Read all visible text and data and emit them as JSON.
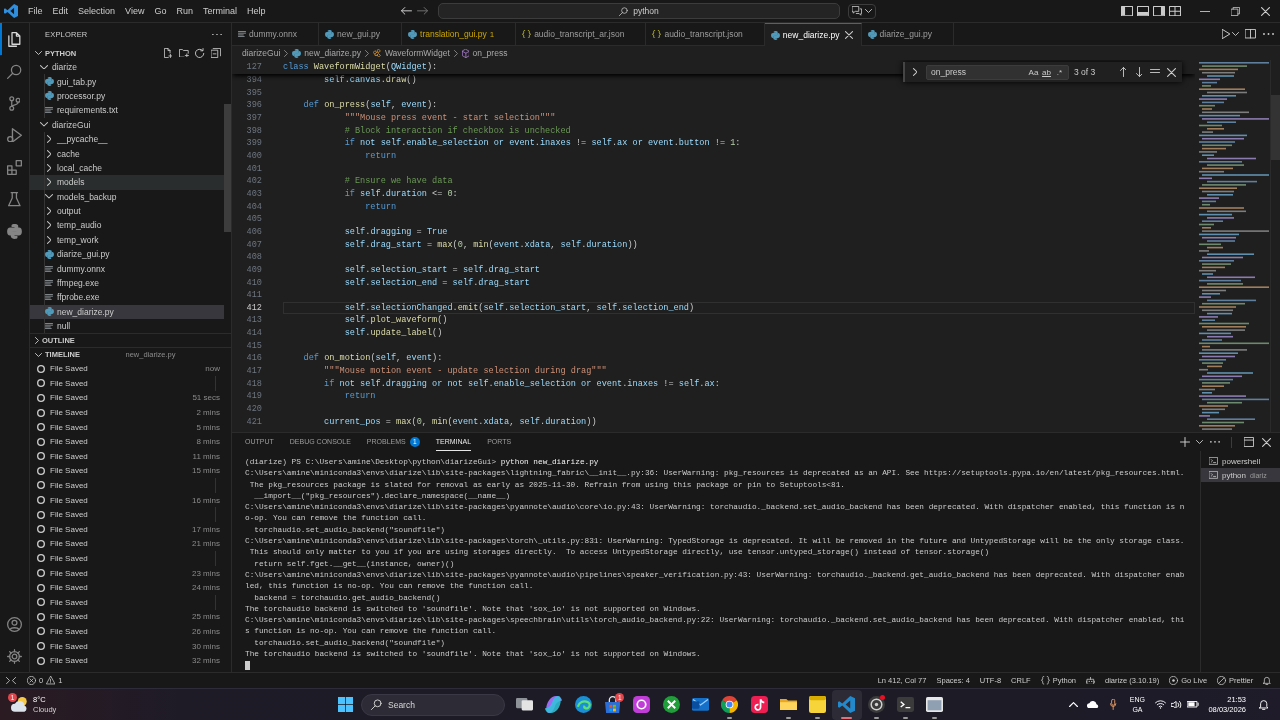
{
  "title_bar": {
    "menu": [
      "File",
      "Edit",
      "Selection",
      "View",
      "Go",
      "Run",
      "Terminal",
      "Help"
    ],
    "command_center": {
      "label": "python"
    }
  },
  "activity_bar": {
    "items": [
      {
        "kind": "explorer",
        "selected": true
      },
      {
        "kind": "search",
        "selected": false
      },
      {
        "kind": "source_control",
        "selected": false
      },
      {
        "kind": "run_debug",
        "selected": false
      },
      {
        "kind": "extensions",
        "selected": false
      },
      {
        "kind": "testing",
        "selected": false
      },
      {
        "kind": "python",
        "selected": false
      }
    ],
    "bottom": [
      {
        "kind": "account"
      },
      {
        "kind": "settings"
      }
    ]
  },
  "sidebar": {
    "title": "EXPLORER",
    "section": {
      "label": "PYTHON",
      "expanded": true
    },
    "tree": [
      {
        "label": "diarize",
        "kind": "folder",
        "expanded": true,
        "selected": false,
        "hovered": false,
        "children": [
          {
            "label": "gui_tab.py",
            "kind": "python",
            "selected": false,
            "hovered": false
          },
          {
            "label": "processor.py",
            "kind": "python",
            "selected": false,
            "hovered": false
          },
          {
            "label": "requirements.txt",
            "kind": "text",
            "selected": false,
            "hovered": false
          }
        ]
      },
      {
        "label": "diarizeGui",
        "kind": "folder",
        "expanded": true,
        "selected": false,
        "hovered": false,
        "children": [
          {
            "label": "__pycache__",
            "kind": "folder",
            "expanded": false,
            "selected": false,
            "hovered": false
          },
          {
            "label": "cache",
            "kind": "folder",
            "expanded": false,
            "selected": false,
            "hovered": false
          },
          {
            "label": "local_cache",
            "kind": "folder",
            "expanded": false,
            "selected": false,
            "hovered": false
          },
          {
            "label": "models",
            "kind": "folder",
            "expanded": false,
            "selected": false,
            "hovered": true
          },
          {
            "label": "models_backup",
            "kind": "folder",
            "expanded": true,
            "selected": false,
            "hovered": false
          },
          {
            "label": "output",
            "kind": "folder",
            "expanded": false,
            "selected": false,
            "hovered": false
          },
          {
            "label": "temp_audio",
            "kind": "folder",
            "expanded": false,
            "selected": false,
            "hovered": false
          },
          {
            "label": "temp_work",
            "kind": "folder",
            "expanded": false,
            "selected": false,
            "hovered": false
          },
          {
            "label": "diarize_gui.py",
            "kind": "python",
            "selected": false,
            "hovered": false
          },
          {
            "label": "dummy.onnx",
            "kind": "text",
            "selected": false,
            "hovered": false
          },
          {
            "label": "ffmpeg.exe",
            "kind": "text",
            "selected": false,
            "hovered": false
          },
          {
            "label": "ffprobe.exe",
            "kind": "text",
            "selected": false,
            "hovered": false
          },
          {
            "label": "new_diarize.py",
            "kind": "python",
            "selected": true,
            "hovered": false
          },
          {
            "label": "null",
            "kind": "text",
            "selected": false,
            "hovered": false
          }
        ]
      }
    ],
    "outline": {
      "label": "OUTLINE",
      "expanded": false
    },
    "timeline": {
      "label": "TIMELINE",
      "file": "new_diarize.py",
      "expanded": true,
      "entries": [
        {
          "label": "File Saved",
          "time": "now"
        },
        {
          "label": "File Saved"
        },
        {
          "label": "File Saved",
          "time": "51 secs"
        },
        {
          "label": "File Saved",
          "time": "2 mins"
        },
        {
          "label": "File Saved",
          "time": "5 mins"
        },
        {
          "label": "File Saved",
          "time": "8 mins"
        },
        {
          "label": "File Saved",
          "time": "11 mins"
        },
        {
          "label": "File Saved",
          "time": "15 mins"
        },
        {
          "label": "File Saved"
        },
        {
          "label": "File Saved",
          "time": "16 mins"
        },
        {
          "label": "File Saved"
        },
        {
          "label": "File Saved",
          "time": "17 mins"
        },
        {
          "label": "File Saved",
          "time": "21 mins"
        },
        {
          "label": "File Saved"
        },
        {
          "label": "File Saved",
          "time": "23 mins"
        },
        {
          "label": "File Saved",
          "time": "24 mins"
        },
        {
          "label": "File Saved"
        },
        {
          "label": "File Saved",
          "time": "25 mins"
        },
        {
          "label": "File Saved",
          "time": "26 mins"
        },
        {
          "label": "File Saved",
          "time": "30 mins"
        },
        {
          "label": "File Saved",
          "time": "32 mins"
        }
      ]
    }
  },
  "editor": {
    "tabs": [
      {
        "label": "dummy.onnx",
        "kind": "text",
        "selected": false,
        "warning": false
      },
      {
        "label": "new_gui.py",
        "kind": "python",
        "selected": false,
        "warning": false
      },
      {
        "label": "translation_gui.py",
        "kind": "python",
        "selected": false,
        "warning": true,
        "problems": "1"
      },
      {
        "label": "audio_transcript_ar.json",
        "kind": "json",
        "selected": false,
        "warning": false
      },
      {
        "label": "audio_transcript.json",
        "kind": "json",
        "selected": false,
        "warning": false
      },
      {
        "label": "new_diarize.py",
        "kind": "python",
        "selected": true,
        "warning": false
      },
      {
        "label": "diarize_gui.py",
        "kind": "python",
        "selected": false,
        "warning": false
      }
    ],
    "breadcrumb": [
      {
        "label": "diarizeGui",
        "kind": "folder"
      },
      {
        "label": "new_diarize.py",
        "kind": "python"
      },
      {
        "label": "WaveformWidget",
        "kind": "class"
      },
      {
        "label": "on_press",
        "kind": "method"
      }
    ],
    "sticky_line": {
      "number": "127",
      "text": "class WaveformWidget(QWidget):"
    },
    "lines": [
      {
        "number": "394",
        "text": "        self.canvas.draw()",
        "current": false
      },
      {
        "number": "395",
        "current": false
      },
      {
        "number": "396",
        "text": "    def on_press(self, event):",
        "current": false
      },
      {
        "number": "397",
        "text": "            \"\"\"Mouse press event - start selection\"\"\"",
        "current": false
      },
      {
        "number": "398",
        "text": "            # Block interaction if checkbox is unchecked",
        "current": false
      },
      {
        "number": "399",
        "text": "            if not self.enable_selection or event.inaxes != self.ax or event.button != 1:",
        "current": false
      },
      {
        "number": "400",
        "text": "                return",
        "current": false
      },
      {
        "number": "401",
        "current": false
      },
      {
        "number": "402",
        "text": "            # Ensure we have data",
        "current": false
      },
      {
        "number": "403",
        "text": "            if self.duration <= 0:",
        "current": false
      },
      {
        "number": "404",
        "text": "                return",
        "current": false
      },
      {
        "number": "405",
        "current": false
      },
      {
        "number": "406",
        "text": "            self.dragging = True",
        "current": false
      },
      {
        "number": "407",
        "text": "            self.drag_start = max(0, min(event.xdata, self.duration))",
        "current": false
      },
      {
        "number": "408",
        "current": false
      },
      {
        "number": "409",
        "text": "            self.selection_start = self.drag_start",
        "current": false
      },
      {
        "number": "410",
        "text": "            self.selection_end = self.drag_start",
        "current": false
      },
      {
        "number": "411",
        "current": false
      },
      {
        "number": "412",
        "text": "            self.selectionChanged.emit(self.selection_start, self.selection_end)",
        "current": true
      },
      {
        "number": "413",
        "text": "            self.plot_waveform()",
        "current": false
      },
      {
        "number": "414",
        "text": "            self.update_label()",
        "current": false
      },
      {
        "number": "415",
        "current": false
      },
      {
        "number": "416",
        "text": "    def on_motion(self, event):",
        "current": false
      },
      {
        "number": "417",
        "text": "        \"\"\"Mouse motion event - update selection during drag\"\"\"",
        "current": false
      },
      {
        "number": "418",
        "text": "        if not self.dragging or not self.enable_selection or event.inaxes != self.ax:",
        "current": false
      },
      {
        "number": "419",
        "text": "            return",
        "current": false
      },
      {
        "number": "420",
        "current": false
      },
      {
        "number": "421",
        "text": "        current_pos = max(0, min(event.xdata, self.duration))",
        "current": false
      }
    ],
    "find": {
      "value": "on_press",
      "options": [
        {
          "kind": "case",
          "label": "Aa",
          "on": false
        },
        {
          "kind": "word",
          "label": "ab",
          "on": false
        },
        {
          "kind": "regex",
          "label": ".*",
          "on": false
        }
      ],
      "result": "3 of 3"
    }
  },
  "panel": {
    "tabs": [
      {
        "label": "OUTPUT",
        "selected": false
      },
      {
        "label": "DEBUG CONSOLE",
        "selected": false
      },
      {
        "label": "PROBLEMS",
        "selected": false,
        "badge": "1"
      },
      {
        "label": "TERMINAL",
        "selected": true
      },
      {
        "label": "PORTS",
        "selected": false
      }
    ],
    "terminal": {
      "prompt": "(diarize) PS C:\\Users\\amine\\Desktop\\python\\diarizeGui>",
      "command": "python new_diarize.py",
      "output": [
        "C:\\Users\\amine\\miniconda3\\envs\\diarize\\lib\\site-packages\\lightning_fabric\\__init__.py:36: UserWarning: pkg_resources is deprecated as an API. See https://setuptools.pypa.io/en/latest/pkg_resources.html.",
        " The pkg_resources package is slated for removal as early as 2025-11-30. Refrain from using this package or pin to Setuptools<81.",
        "  __import__(\"pkg_resources\").declare_namespace(__name__)",
        "C:\\Users\\amine\\miniconda3\\envs\\diarize\\lib\\site-packages\\pyannote\\audio\\core\\io.py:43: UserWarning: torchaudio._backend.set_audio_backend has been deprecated. With dispatcher enabled, this function is n",
        "o-op. You can remove the function call.",
        "  torchaudio.set_audio_backend(\"soundfile\")",
        "C:\\Users\\amine\\miniconda3\\envs\\diarize\\lib\\site-packages\\torch\\_utils.py:831: UserWarning: TypedStorage is deprecated. It will be removed in the future and UntypedStorage will be the only storage class.",
        " This should only matter to you if you are using storages directly.  To access UntypedStorage directly, use tensor.untyped_storage() instead of tensor.storage()",
        "  return self.fget.__get__(instance, owner)()",
        "C:\\Users\\amine\\miniconda3\\envs\\diarize\\lib\\site-packages\\pyannote\\audio\\pipelines\\speaker_verification.py:43: UserWarning: torchaudio._backend.get_audio_backend has been deprecated. With dispatcher enab",
        "led, this function is no-op. You can remove the function call.",
        "  backend = torchaudio.get_audio_backend()",
        "The torchaudio backend is switched to 'soundfile'. Note that 'sox_io' is not supported on Windows.",
        "C:\\Users\\amine\\miniconda3\\envs\\diarize\\lib\\site-packages\\speechbrain\\utils\\torch_audio_backend.py:22: UserWarning: torchaudio._backend.set_audio_backend has been deprecated. With dispatcher enabled, thi",
        "s function is no-op. You can remove the function call.",
        "  torchaudio.set_audio_backend(\"soundfile\")",
        "The torchaudio backend is switched to 'soundfile'. Note that 'sox_io' is not supported on Windows."
      ]
    },
    "terminals": [
      {
        "label": "powershell",
        "selected": false
      },
      {
        "label": "python",
        "description": "diariz",
        "selected": true
      }
    ]
  },
  "status_bar": {
    "errors": "0",
    "warnings": "1",
    "items": [
      {
        "kind": "text",
        "label": "Ln 412, Col 77"
      },
      {
        "kind": "text",
        "label": "Spaces: 4"
      },
      {
        "kind": "text",
        "label": "UTF-8"
      },
      {
        "kind": "text",
        "label": "CRLF"
      },
      {
        "kind": "braces",
        "label": "Python"
      },
      {
        "kind": "robot"
      },
      {
        "kind": "text",
        "label": "diarize (3.10.19)"
      },
      {
        "kind": "circle_dot",
        "label": "Go Live"
      },
      {
        "kind": "circle_slash",
        "label": "Prettier"
      },
      {
        "kind": "bell"
      }
    ]
  },
  "taskbar": {
    "weather": {
      "temperature": "8°C",
      "condition": "Cloudy",
      "badge": "1"
    },
    "search": {
      "placeholder": "Search"
    },
    "apps": [
      {
        "kind": "task_view",
        "running": false,
        "active": false,
        "alert": false
      },
      {
        "kind": "swirl",
        "running": false,
        "active": false,
        "alert": false
      },
      {
        "kind": "wave",
        "running": false,
        "active": false,
        "alert": false
      },
      {
        "kind": "store",
        "running": false,
        "active": false,
        "alert": false,
        "badge": "1"
      },
      {
        "kind": "rounded",
        "running": false,
        "active": false,
        "alert": false
      },
      {
        "kind": "xcircle",
        "running": false,
        "active": false,
        "alert": false
      },
      {
        "kind": "mail",
        "running": false,
        "active": false,
        "alert": false
      },
      {
        "kind": "segments",
        "running": true,
        "active": false,
        "alert": false
      },
      {
        "kind": "note",
        "running": false,
        "active": false,
        "alert": false
      },
      {
        "kind": "folder",
        "running": true,
        "active": false,
        "alert": false
      },
      {
        "kind": "sticky",
        "running": true,
        "active": false,
        "alert": false
      },
      {
        "kind": "ribbon",
        "running": true,
        "active": true,
        "alert": false
      },
      {
        "kind": "aperture",
        "running": true,
        "active": false,
        "alert": true
      },
      {
        "kind": "terminal",
        "running": true,
        "active": false,
        "alert": false
      },
      {
        "kind": "window",
        "running": true,
        "active": false,
        "alert": false
      }
    ],
    "tray": {
      "language": "ENG",
      "layout": "GA",
      "time": "21:53",
      "date": "08/03/2026"
    }
  }
}
